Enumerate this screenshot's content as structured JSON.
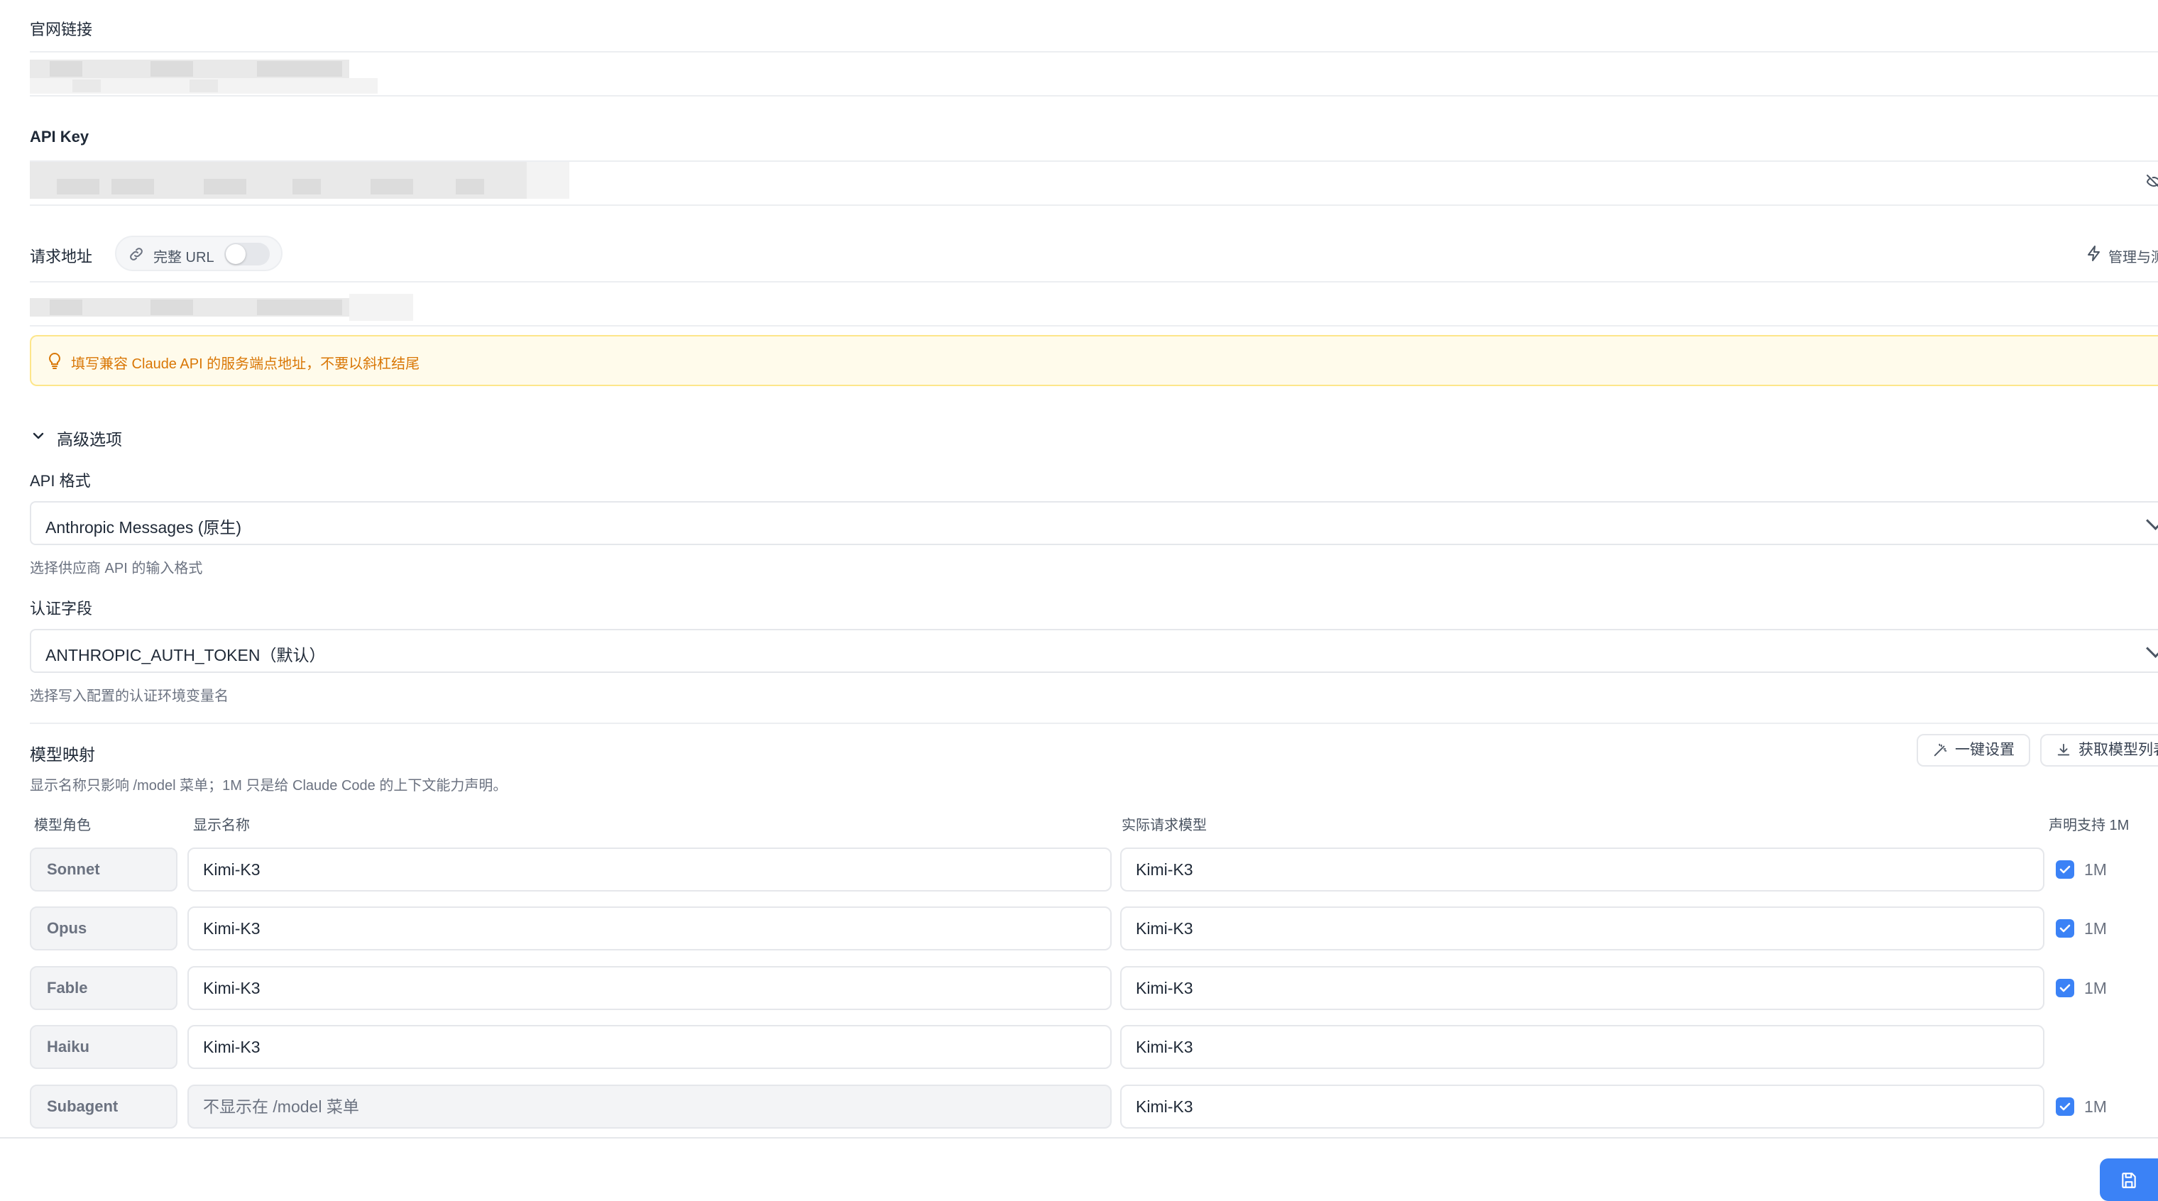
{
  "website": {
    "label": "官网链接"
  },
  "api_key": {
    "label": "API Key"
  },
  "request_url": {
    "label": "请求地址",
    "full_url_label": "完整 URL",
    "manage_label": "管理与测",
    "hint": "填写兼容 Claude API 的服务端点地址，不要以斜杠结尾"
  },
  "advanced": {
    "title": "高级选项",
    "api_format": {
      "label": "API 格式",
      "value": "Anthropic Messages (原生)",
      "help": "选择供应商 API 的输入格式"
    },
    "auth_field": {
      "label": "认证字段",
      "value": "ANTHROPIC_AUTH_TOKEN（默认）",
      "help": "选择写入配置的认证环境变量名"
    }
  },
  "model_mapping": {
    "title": "模型映射",
    "desc": "显示名称只影响 /model 菜单；1M 只是给 Claude Code 的上下文能力声明。",
    "one_click_label": "一键设置",
    "fetch_models_label": "获取模型列表",
    "columns": {
      "role": "模型角色",
      "display": "显示名称",
      "actual": "实际请求模型",
      "support": "声明支持 1M"
    },
    "rows": [
      {
        "role": "Sonnet",
        "display": "Kimi-K3",
        "actual": "Kimi-K3",
        "checked": true,
        "badge": "1M"
      },
      {
        "role": "Opus",
        "display": "Kimi-K3",
        "actual": "Kimi-K3",
        "checked": true,
        "badge": "1M"
      },
      {
        "role": "Fable",
        "display": "Kimi-K3",
        "actual": "Kimi-K3",
        "checked": true,
        "badge": "1M"
      },
      {
        "role": "Haiku",
        "display": "Kimi-K3",
        "actual": "Kimi-K3",
        "checked": false,
        "badge": ""
      },
      {
        "role": "Subagent",
        "display_placeholder": "不显示在 /model 菜单",
        "actual": "Kimi-K3",
        "checked": true,
        "badge": "1M"
      }
    ]
  },
  "colors": {
    "accent": "#3b82f6",
    "warning_bg": "#fffbeb",
    "warning_text": "#d97706"
  }
}
